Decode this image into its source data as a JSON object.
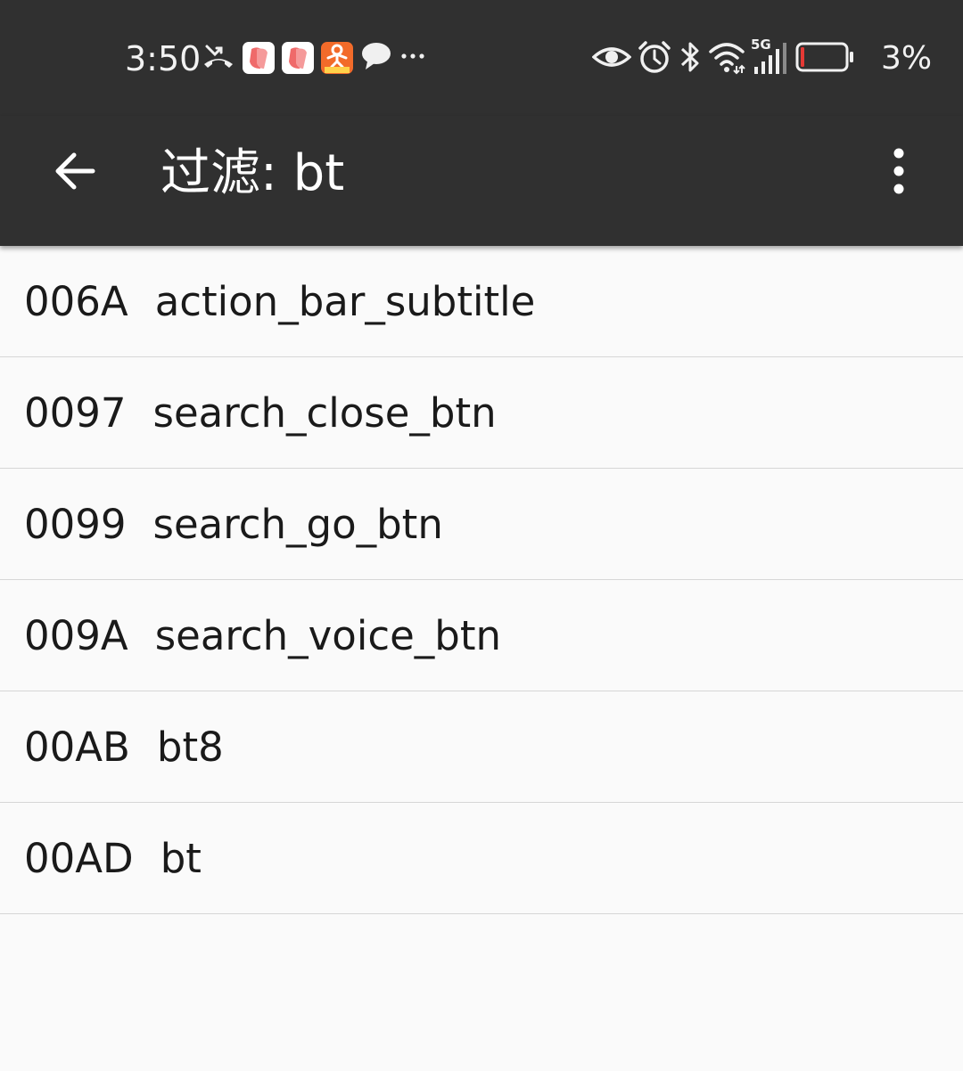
{
  "status_bar": {
    "time": "3:50",
    "battery_percent": "3%",
    "battery_level": 0.03,
    "network_label": "5G",
    "left_icons": [
      "missed-call-icon",
      "app-notification-icon",
      "app-notification-icon",
      "app-notification-icon",
      "chat-bubble-icon",
      "more-dots-icon"
    ],
    "right_icons": [
      "eye-icon",
      "alarm-icon",
      "bluetooth-icon",
      "wifi-icon",
      "signal-icon",
      "battery-icon"
    ]
  },
  "toolbar": {
    "title": "过滤: bt",
    "back_icon": "arrow-left-icon",
    "menu_icon": "more-vert-icon"
  },
  "list": {
    "items": [
      {
        "id": "006A",
        "name": "action_bar_subtitle"
      },
      {
        "id": "0097",
        "name": "search_close_btn"
      },
      {
        "id": "0099",
        "name": "search_go_btn"
      },
      {
        "id": "009A",
        "name": "search_voice_btn"
      },
      {
        "id": "00AB",
        "name": "bt8"
      },
      {
        "id": "00AD",
        "name": "bt"
      }
    ]
  },
  "colors": {
    "bar_background": "#303030",
    "list_background": "#fafafa",
    "divider": "#d6d6d6",
    "text_primary": "#1a1a1a",
    "battery_low": "#e53935"
  }
}
